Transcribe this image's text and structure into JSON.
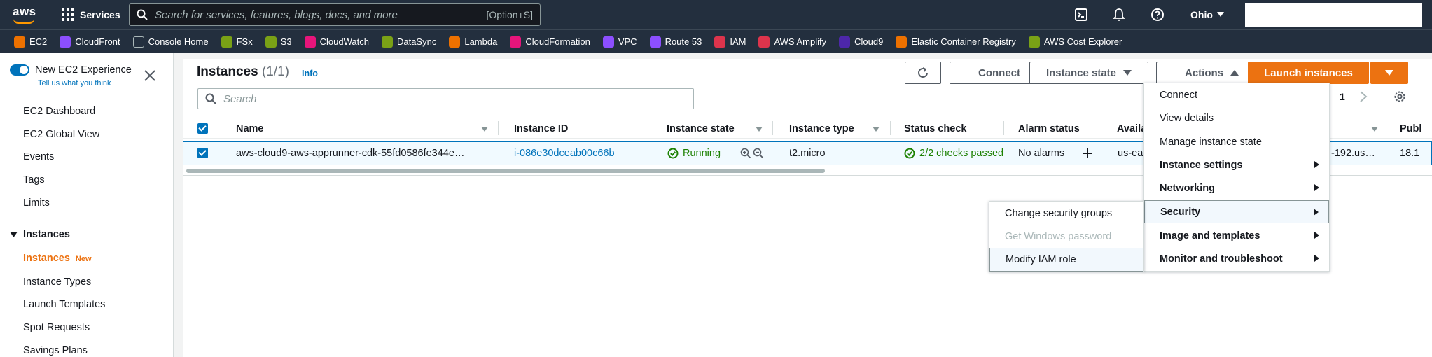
{
  "topnav": {
    "logo_text": "aws",
    "services_label": "Services",
    "search_placeholder": "Search for services, features, blogs, docs, and more",
    "search_shortcut": "[Option+S]",
    "region": "Ohio"
  },
  "favorites": [
    {
      "label": "EC2",
      "color": "#ed7100"
    },
    {
      "label": "CloudFront",
      "color": "#8c4fff"
    },
    {
      "label": "Console Home",
      "color": "#232f3e"
    },
    {
      "label": "FSx",
      "color": "#7aa116"
    },
    {
      "label": "S3",
      "color": "#7aa116"
    },
    {
      "label": "CloudWatch",
      "color": "#e7157b"
    },
    {
      "label": "DataSync",
      "color": "#7aa116"
    },
    {
      "label": "Lambda",
      "color": "#ed7100"
    },
    {
      "label": "CloudFormation",
      "color": "#e7157b"
    },
    {
      "label": "VPC",
      "color": "#8c4fff"
    },
    {
      "label": "Route 53",
      "color": "#8c4fff"
    },
    {
      "label": "IAM",
      "color": "#dd344c"
    },
    {
      "label": "AWS Amplify",
      "color": "#dd344c"
    },
    {
      "label": "Cloud9",
      "color": "#4d27aa"
    },
    {
      "label": "Elastic Container Registry",
      "color": "#ed7100"
    },
    {
      "label": "AWS Cost Explorer",
      "color": "#7aa116"
    }
  ],
  "sidebar": {
    "experience_title": "New EC2 Experience",
    "experience_sub": "Tell us what you think",
    "items_top": [
      "EC2 Dashboard",
      "EC2 Global View",
      "Events",
      "Tags",
      "Limits"
    ],
    "section_instances": "Instances",
    "instances_items": [
      "Instances",
      "Instance Types",
      "Launch Templates",
      "Spot Requests",
      "Savings Plans"
    ],
    "new_badge": "New"
  },
  "panel": {
    "title": "Instances",
    "count": "(1/1)",
    "info": "Info",
    "connect_label": "Connect",
    "instance_state_label": "Instance state",
    "actions_label": "Actions",
    "launch_label": "Launch instances",
    "search_placeholder": "Search",
    "page_number": "1"
  },
  "table": {
    "columns": [
      "Name",
      "Instance ID",
      "Instance state",
      "Instance type",
      "Status check",
      "Alarm status",
      "Availa",
      "Publ"
    ],
    "row": {
      "name": "aws-cloud9-aws-apprunner-cdk-55fd0586fe344e…",
      "instance_id": "i-086e30dceab00c66b",
      "state": "Running",
      "type": "t2.micro",
      "status_check": "2/2 checks passed",
      "alarm": "No alarms",
      "az": "us-ea",
      "dns": "-192.us…",
      "public_ip": "18.1"
    }
  },
  "actions_menu": [
    "Connect",
    "View details",
    "Manage instance state",
    "Instance settings",
    "Networking",
    "Security",
    "Image and templates",
    "Monitor and troubleshoot"
  ],
  "security_menu": [
    "Change security groups",
    "Get Windows password",
    "Modify IAM role"
  ],
  "colors": {
    "nav_bg": "#232f3e",
    "accent": "#ec7211",
    "link": "#0073bb",
    "success": "#1d8102"
  }
}
